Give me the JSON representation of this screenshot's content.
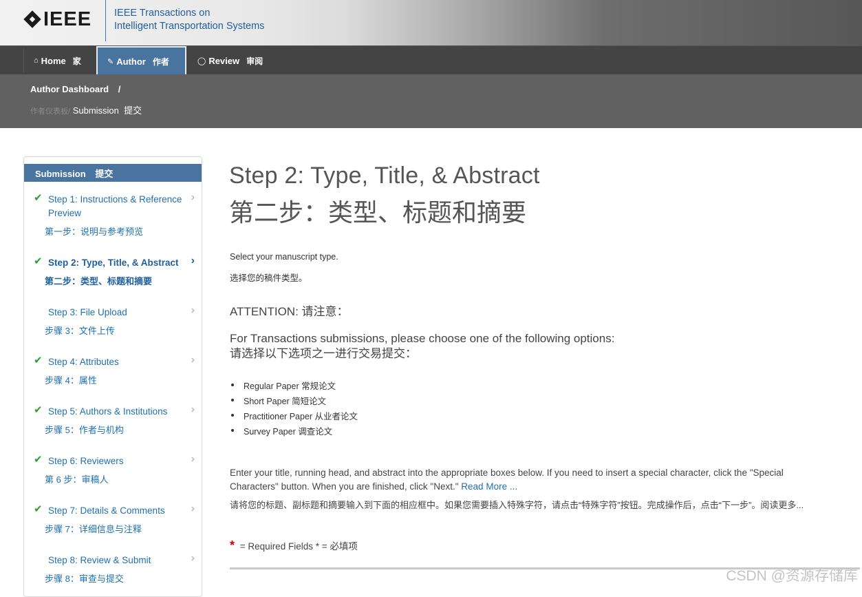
{
  "header": {
    "logo_text": "IEEE",
    "journal_line1": "IEEE Transactions on",
    "journal_line2": "Intelligent Transportation Systems"
  },
  "nav": {
    "home": {
      "label": "Home",
      "cn": "家",
      "icon": "home-icon"
    },
    "author": {
      "label": "Author",
      "cn": "作者",
      "icon": "pencil-icon"
    },
    "review": {
      "label": "Review",
      "cn": "审阅",
      "icon": "speech-bubble-icon"
    }
  },
  "breadcrumb": {
    "level1": "Author Dashboard",
    "level1_sep": "/",
    "level1_cn": "作者仪表板",
    "level1_cn_sep": "/",
    "current": "Submission",
    "current_cn": "提交"
  },
  "sidebar": {
    "title": "Submission",
    "title_cn": "提交",
    "steps": [
      {
        "label": "Step 1: Instructions & Reference Preview",
        "cn": "第一步：说明与参考预览",
        "done": true,
        "check": "✔",
        "chev": "›"
      },
      {
        "label": "Step 2: Type, Title, & Abstract",
        "cn": "第二步：类型、标题和摘要",
        "done": true,
        "current": true,
        "check": "✔",
        "chev": "›"
      },
      {
        "label": "Step 3: File Upload",
        "cn": "步骤 3：文件上传",
        "done": false,
        "check": "",
        "chev": "›"
      },
      {
        "label": "Step 4: Attributes",
        "cn": "步骤 4：属性",
        "done": true,
        "check": "✔",
        "chev": "›"
      },
      {
        "label": "Step 5: Authors & Institutions",
        "cn": "步骤 5：作者与机构",
        "done": true,
        "check": "✔",
        "chev": "›"
      },
      {
        "label": "Step 6: Reviewers",
        "cn": "第 6 步：审稿人",
        "done": true,
        "check": "✔",
        "chev": "›"
      },
      {
        "label": "Step 7: Details & Comments",
        "cn": "步骤 7：详细信息与注释",
        "done": true,
        "check": "✔",
        "chev": "›"
      },
      {
        "label": "Step 8: Review & Submit",
        "cn": "步骤 8：审查与提交",
        "done": false,
        "check": "",
        "chev": "›"
      }
    ]
  },
  "main": {
    "title": "Step 2: Type, Title, & Abstract",
    "title_cn": "第二步：类型、标题和摘要",
    "select_type": "Select your manuscript type.",
    "select_type_cn": "选择您的稿件类型。",
    "attention": "ATTENTION:  请注意：",
    "options_intro": "For Transactions submissions, please choose one of the following options:",
    "options_intro_cn": "请选择以下选项之一进行交易提交：",
    "options": [
      "Regular Paper  常规论文",
      "Short Paper  简短论文",
      "Practitioner Paper  从业者论文",
      "Survey Paper  调查论文"
    ],
    "instructions": "Enter your title, running head, and abstract into the appropriate boxes below. If you need to insert a special character, click the \"Special Characters\" button. When you are finished, click \"Next.\"",
    "read_more": "Read More ...",
    "instructions_cn": "请将您的标题、副标题和摘要输入到下面的相应框中。如果您需要插入特殊字符，请点击“特殊字符”按钮。完成操作后，点击“下一步”。阅读更多...",
    "required_star": "*",
    "required_text": "= Required Fields  * = 必填项"
  },
  "watermark": "CSDN @资源存储库",
  "colors": {
    "nav_active": "#4a74a0",
    "link": "#1f70b0",
    "check": "#2ca02c",
    "required": "#d40000"
  }
}
